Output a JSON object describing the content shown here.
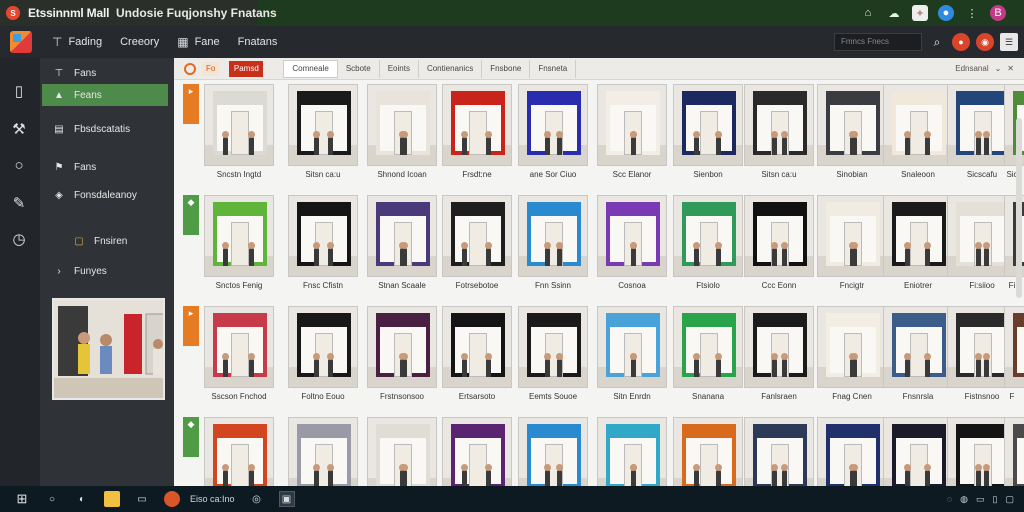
{
  "window": {
    "app_badge": "S",
    "title": "Etssinnml Mall",
    "subtitle": "Undosie Fuqjonshy Fnatans"
  },
  "titlebar_icons": [
    "home-icon",
    "cloud-icon",
    "extension-icon",
    "account-icon",
    "more-icon",
    "profile-icon"
  ],
  "toolbar": {
    "menu": [
      {
        "icon": "tag-icon",
        "label": "Fading"
      },
      {
        "icon": "",
        "label": "Creeory"
      },
      {
        "icon": "grid-icon",
        "label": "Fane"
      },
      {
        "icon": "",
        "label": "Fnatans"
      }
    ],
    "search_placeholder": "Fmncs Fnecs"
  },
  "sidebar": {
    "items": [
      {
        "icon": "tool-icon",
        "label": "Fans"
      },
      {
        "icon": "flask-icon",
        "label": "Feans"
      },
      {
        "icon": "table-icon",
        "label": "Fbsdscatatis"
      },
      {
        "icon": "flag-icon",
        "label": "Fans"
      },
      {
        "icon": "stack-icon",
        "label": "Fonsdaleanoy"
      },
      {
        "icon": "square-icon",
        "label": "Fnsiren"
      },
      {
        "icon": "chevron-icon",
        "label": "Funyes"
      }
    ],
    "active_index": 1
  },
  "content_bar": {
    "badge": "Fo",
    "red_button": "Pamsd",
    "tabs": [
      "Comneale",
      "Scbote",
      "Eoints",
      "Contienanics",
      "Fnsbone",
      "Fnsneta"
    ],
    "active_tab": 0,
    "right_label": "Ednsanal"
  },
  "grid_rows": [
    {
      "marker": "orange",
      "cards": [
        {
          "caption": "Sncstn Ingtd",
          "color": "#dcdad4"
        },
        {
          "caption": "Sitsn ca:u",
          "color": "#1a1a1a"
        },
        {
          "caption": "Shnond Icoan",
          "color": "#e8e4dc"
        },
        {
          "caption": "Frsdt:ne",
          "color": "#c8241c"
        },
        {
          "caption": "ane Sor Ciuo",
          "color": "#2a2cb0"
        },
        {
          "caption": "Scc Elanor",
          "color": "#f2eee6"
        },
        {
          "caption": "Sienbon",
          "color": "#1c2860"
        },
        {
          "caption": "Sitsn ca:u",
          "color": "#2a2a2a"
        },
        {
          "caption": "Sinobian",
          "color": "#3a3c42"
        },
        {
          "caption": "Snaleoon",
          "color": "#f0e8da"
        },
        {
          "caption": "Sicscafu",
          "color": "#23467a"
        },
        {
          "caption": "Sic",
          "color": "#4f8c3a"
        }
      ]
    },
    {
      "marker": "green",
      "cards": [
        {
          "caption": "Snctos Fenig",
          "color": "#5fb43a"
        },
        {
          "caption": "Fnsc Cfistn",
          "color": "#151515"
        },
        {
          "caption": "Stnan Scaale",
          "color": "#4a3a7a"
        },
        {
          "caption": "Fotrsebotoe",
          "color": "#1e1e1e"
        },
        {
          "caption": "Fnn Ssinn",
          "color": "#2a8ad0"
        },
        {
          "caption": "Cosnoa",
          "color": "#7a3ab4"
        },
        {
          "caption": "Ftsiolo",
          "color": "#2f9a5a"
        },
        {
          "caption": "Ccc Eonn",
          "color": "#111111"
        },
        {
          "caption": "Fncigtr",
          "color": "#f1ece2"
        },
        {
          "caption": "Eniotrer",
          "color": "#1a1a1a"
        },
        {
          "caption": "Fi:siioo",
          "color": "#e4e0d8"
        },
        {
          "caption": "Fi",
          "color": "#3a3a3a"
        }
      ]
    },
    {
      "marker": "orange",
      "cards": [
        {
          "caption": "Sscson Fnchod",
          "color": "#c73a4a"
        },
        {
          "caption": "Foltno Eouo",
          "color": "#181818"
        },
        {
          "caption": "Frstnsonsoo",
          "color": "#4a2042"
        },
        {
          "caption": "Ertsarsoto",
          "color": "#141414"
        },
        {
          "caption": "Eemts Souoe",
          "color": "#1a1a1a"
        },
        {
          "caption": "Sitn Enrdn",
          "color": "#4aa3d8"
        },
        {
          "caption": "Snanana",
          "color": "#2aa44a"
        },
        {
          "caption": "Fanlsraen",
          "color": "#1b1b1b"
        },
        {
          "caption": "Fnag Cnen",
          "color": "#f3eee4"
        },
        {
          "caption": "Fnsnrsla",
          "color": "#3c5c8a"
        },
        {
          "caption": "Fistnsnoo",
          "color": "#2a2a2a"
        },
        {
          "caption": "F",
          "color": "#6a3c2c"
        }
      ]
    },
    {
      "marker": "green",
      "cards": [
        {
          "caption": "",
          "color": "#d2451e"
        },
        {
          "caption": "",
          "color": "#9a9aa6"
        },
        {
          "caption": "",
          "color": "#e0ddd6"
        },
        {
          "caption": "",
          "color": "#5a2470"
        },
        {
          "caption": "",
          "color": "#2a8ad0"
        },
        {
          "caption": "",
          "color": "#32a8c8"
        },
        {
          "caption": "",
          "color": "#d86a1e"
        },
        {
          "caption": "",
          "color": "#2c3a58"
        },
        {
          "caption": "",
          "color": "#20306a"
        },
        {
          "caption": "",
          "color": "#1a1a2a"
        },
        {
          "caption": "",
          "color": "#141414"
        },
        {
          "caption": "",
          "color": "#4a4a4a"
        }
      ]
    }
  ],
  "taskbar": {
    "label": "Eiso ca:Ino"
  }
}
